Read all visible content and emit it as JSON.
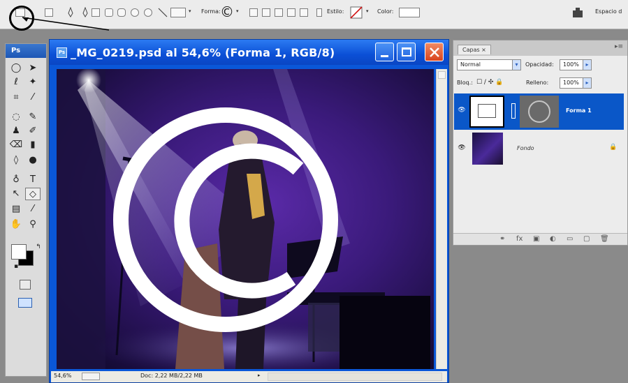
{
  "options_bar": {
    "forma_label": "Forma:",
    "estilo_label": "Estilo:",
    "color_label": "Color:",
    "workspace_label": "Espacio d"
  },
  "tools_panel": {
    "logo": "Ps"
  },
  "document": {
    "title": "_MG_0219.psd al 54,6% (Forma 1, RGB/8)",
    "icon_text": "Ps",
    "zoom": "54,6%",
    "doc_info": "Doc: 2,22 MB/2,22 MB"
  },
  "layers_panel": {
    "tab": "Capas ×",
    "blend_mode": "Normal",
    "opacity_label": "Opacidad:",
    "opacity_value": "100%",
    "lock_label": "Bloq.:",
    "fill_label": "Relleno:",
    "fill_value": "100%",
    "layers": [
      {
        "name": "Forma 1",
        "selected": true
      },
      {
        "name": "Fondo",
        "selected": false
      }
    ]
  },
  "colors": {
    "title_blue": "#0b4fd6",
    "selected_layer": "#0a57c8",
    "close_button": "#d9431d"
  }
}
